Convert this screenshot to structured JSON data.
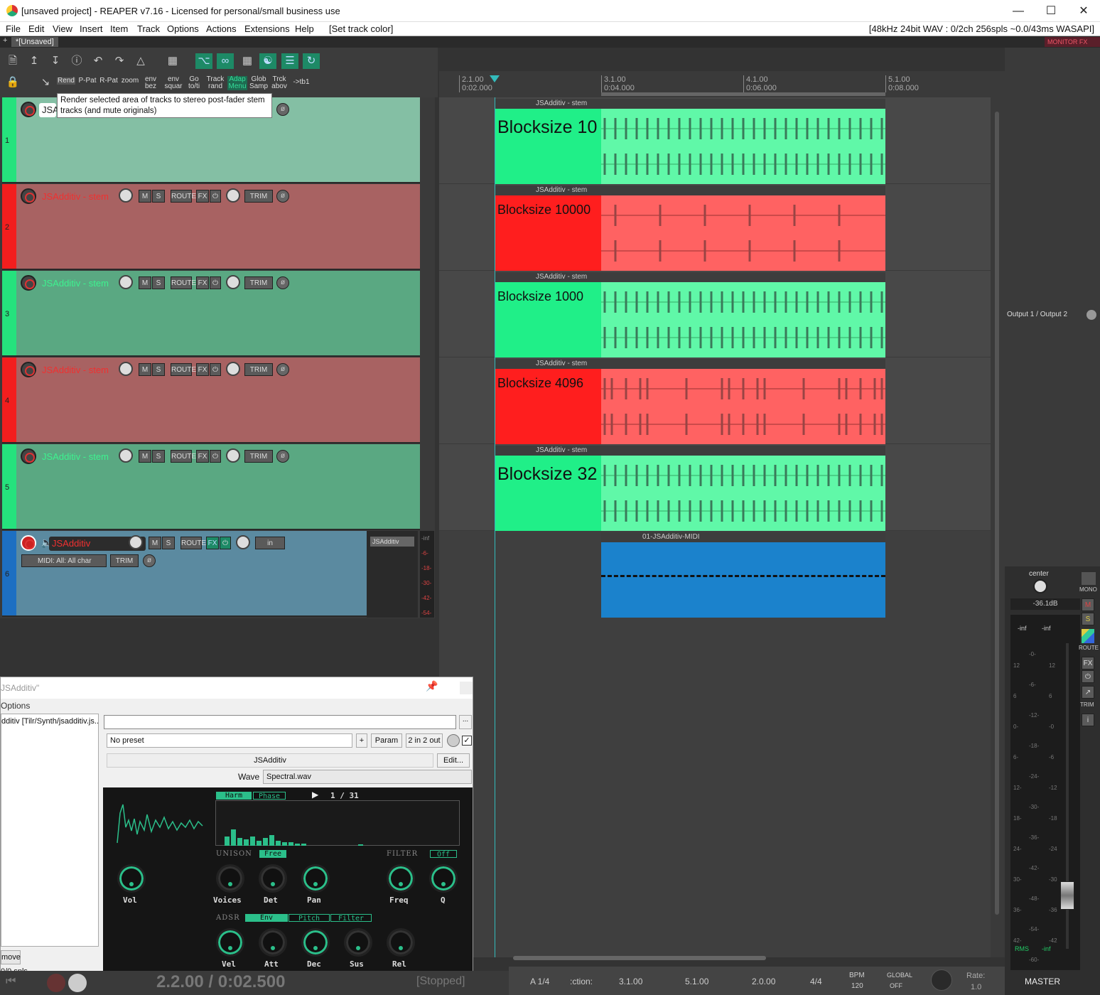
{
  "window": {
    "title": "[unsaved project] - REAPER v7.16 - Licensed for personal/small business use"
  },
  "menu": {
    "items": [
      "File",
      "Edit",
      "View",
      "Insert",
      "Item",
      "Track",
      "Options",
      "Actions",
      "Extensions",
      "Help",
      "[Set track color]"
    ],
    "status": "[48kHz 24bit WAV : 0/2ch 256spls ~0.0/43ms WASAPI]"
  },
  "tab": {
    "label": "*[Unsaved]",
    "monitor": "MONITOR FX"
  },
  "toolbar": {
    "labels": [
      "Rend",
      "P-Pat",
      "R-Pat",
      "zoom",
      "env bez",
      "env squar",
      "Go to/ti",
      "Track rand",
      "Adap Menu",
      "Glob Samp",
      "Trck abov",
      "->tb1"
    ]
  },
  "tooltip": "Render selected area of tracks to stereo post-fader stem tracks (and mute originals)",
  "tracks": [
    {
      "num": "1",
      "name": "JSA",
      "label": "Blocksize 10",
      "item": "JSAdditiv - stem"
    },
    {
      "num": "2",
      "name": "JSAdditiv - stem",
      "label": "Blocksize 10000",
      "item": "JSAdditiv - stem"
    },
    {
      "num": "3",
      "name": "JSAdditiv - stem",
      "label": "Blocksize 1000",
      "item": "JSAdditiv - stem"
    },
    {
      "num": "4",
      "name": "JSAdditiv - stem",
      "label": "Blocksize 4096",
      "item": "JSAdditiv - stem"
    },
    {
      "num": "5",
      "name": "JSAdditiv - stem",
      "label": "Blocksize 32",
      "item": "JSAdditiv - stem"
    },
    {
      "num": "6",
      "name": "JSAdditiv",
      "label": "",
      "item": "01-JSAdditiv-MIDI"
    }
  ],
  "track_buttons": {
    "m": "M",
    "s": "S",
    "route": "ROUTE",
    "fx": "FX",
    "trim": "TRIM",
    "in": "in",
    "midi": "MIDI: All: All char",
    "fxname": "JSAdditiv"
  },
  "meter_ticks": [
    "-inf",
    "-6-",
    "-18-",
    "-30-",
    "-42-",
    "-54-"
  ],
  "ruler": [
    {
      "bar": "2.1.00",
      "time": "0:02.000"
    },
    {
      "bar": "3.1.00",
      "time": "0:04.000"
    },
    {
      "bar": "4.1.00",
      "time": "0:06.000"
    },
    {
      "bar": "5.1.00",
      "time": "0:08.000"
    }
  ],
  "master": {
    "output": "Output 1 / Output 2",
    "pan": "center",
    "vol": "-36.1dB",
    "peakL": "-inf",
    "peakR": "-inf",
    "rms": "RMS",
    "rmsval": "-inf",
    "name": "MASTER",
    "mono": "MONO",
    "route": "ROUTE",
    "trim": "TRIM",
    "fx": "FX",
    "m": "M",
    "s": "S",
    "info": "i",
    "scaleL": [
      "12",
      "6",
      "0-",
      "6-",
      "12-",
      "18-",
      "24-",
      "30-",
      "36-",
      "42-"
    ],
    "scaleC": [
      "-0-",
      "-6-",
      "-12-",
      "-18-",
      "-24-",
      "-30-",
      "-36-",
      "-42-",
      "-48-",
      "-54-",
      "-60-"
    ],
    "scaleR": [
      "12",
      "6",
      "-0",
      "-6",
      "-12",
      "-18",
      "-24",
      "-30",
      "-36",
      "-42"
    ]
  },
  "fx": {
    "title": "JSAdditiv\"",
    "options": "Options",
    "path": "dditiv [Tilr/Synth/jsadditiv.js...",
    "preset": "No preset",
    "plus": "+",
    "param": "Param",
    "io": "2 in 2 out",
    "name": "JSAdditiv",
    "edit": "Edit...",
    "wave_label": "Wave",
    "wave": "Spectral.wav",
    "remove": "move",
    "spls": "0/0 spls",
    "browse": "..."
  },
  "synth": {
    "harm": "Harm",
    "phase": "Phase",
    "page": "1 / 31",
    "unison": "UNISON",
    "free": "Free",
    "filter": "FILTER",
    "off": "Off",
    "adsr": "ADSR",
    "env": "Env",
    "pitch": "Pitch",
    "filt": "Filter",
    "knobs1": [
      "Vol",
      "Voices",
      "Det",
      "Pan",
      "Freq",
      "Q"
    ],
    "knobs2": [
      "Vel",
      "Att",
      "Dec",
      "Sus",
      "Rel"
    ]
  },
  "transport": {
    "pos": "2.2.00 / 0:02.500",
    "state": "[Stopped]"
  },
  "bottom": {
    "a": "A 1/4",
    "sel": ":ction:",
    "start": "3.1.00",
    "end": "5.1.00",
    "len": "2.0.00",
    "sig": "4/4",
    "bpm": "BPM",
    "bpmval": "120",
    "global": "GLOBAL",
    "off": "OFF",
    "rate": "Rate:",
    "rateval": "1.0"
  }
}
